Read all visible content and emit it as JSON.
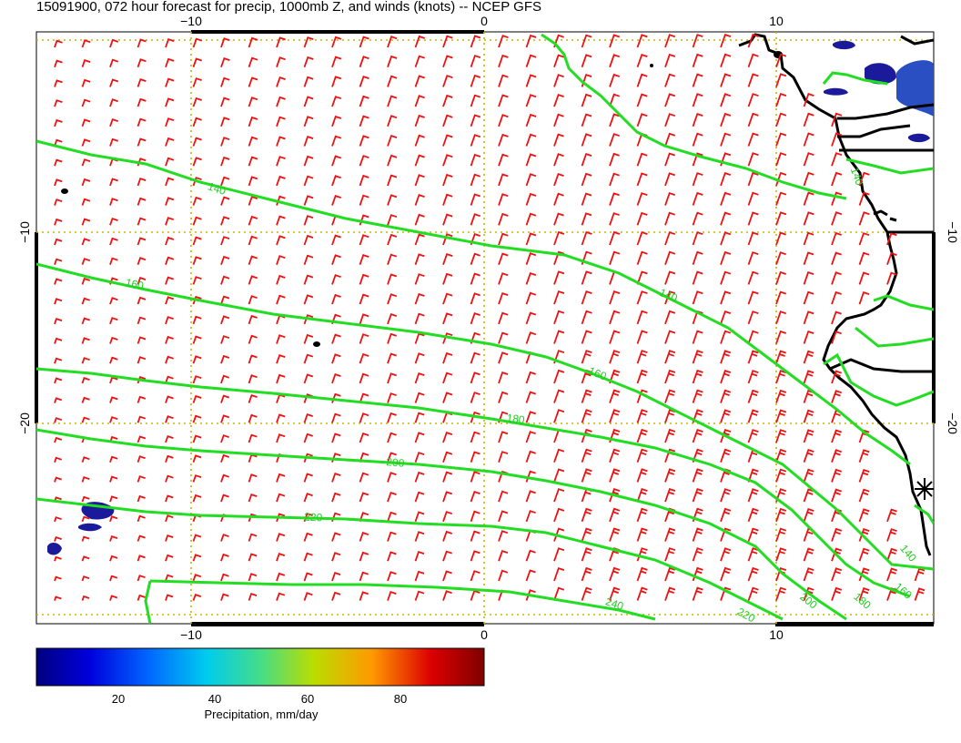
{
  "title": "15091900, 072 hour forecast for precip, 1000mb Z, and winds (knots) -- NCEP GFS",
  "x_ticks": [
    "−10",
    "0",
    "10"
  ],
  "y_ticks": [
    "−10",
    "−20"
  ],
  "colorbar": {
    "label": "Precipitation, mm/day",
    "ticks": [
      "20",
      "40",
      "60",
      "80"
    ]
  },
  "contour_labels": [
    "140",
    "160",
    "140",
    "160",
    "180",
    "200",
    "220",
    "240",
    "220",
    "200",
    "180",
    "160",
    "140",
    "140",
    "120"
  ],
  "colors": {
    "contour": "#22dd22",
    "barb": "#ee1111",
    "grid": "#c8b400",
    "coast": "#000000",
    "precip_dark": "#1a1a9a",
    "precip_mid": "#2255cc"
  },
  "legend_symbol": "station-star-icon"
}
